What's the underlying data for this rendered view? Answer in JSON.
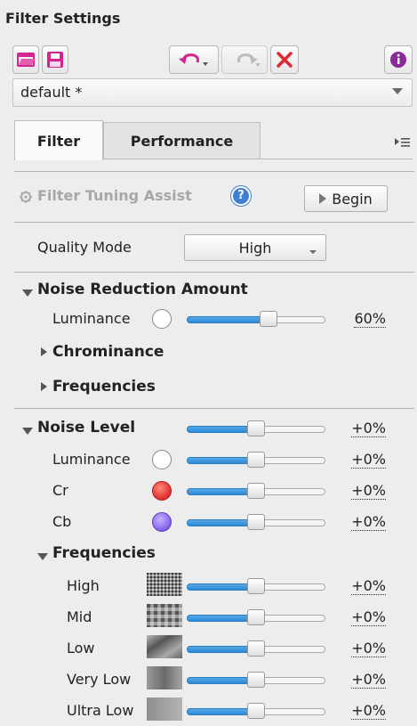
{
  "panel": {
    "title": "Filter Settings"
  },
  "preset": {
    "value": "default *"
  },
  "tabs": [
    {
      "label": "Filter"
    },
    {
      "label": "Performance"
    }
  ],
  "assist": {
    "label": "Filter Tuning Assist",
    "help": "?",
    "begin_label": "Begin"
  },
  "quality": {
    "label": "Quality Mode",
    "value": "High"
  },
  "noise_reduction": {
    "title": "Noise Reduction Amount",
    "luminance": {
      "label": "Luminance",
      "value": "60%",
      "fraction": 0.6
    },
    "chrominance": {
      "label": "Chrominance"
    },
    "frequencies": {
      "label": "Frequencies"
    }
  },
  "noise_level": {
    "title": "Noise Level",
    "main": {
      "value": "+0%",
      "fraction": 0.5
    },
    "luminance": {
      "label": "Luminance",
      "value": "+0%",
      "fraction": 0.5
    },
    "cr": {
      "label": "Cr",
      "value": "+0%",
      "fraction": 0.5
    },
    "cb": {
      "label": "Cb",
      "value": "+0%",
      "fraction": 0.5
    },
    "frequencies_title": "Frequencies",
    "frequencies": [
      {
        "label": "High",
        "value": "+0%",
        "fraction": 0.5
      },
      {
        "label": "Mid",
        "value": "+0%",
        "fraction": 0.5
      },
      {
        "label": "Low",
        "value": "+0%",
        "fraction": 0.5
      },
      {
        "label": "Very Low",
        "value": "+0%",
        "fraction": 0.5
      },
      {
        "label": "Ultra Low",
        "value": "+0%",
        "fraction": 0.5
      }
    ]
  },
  "colors": {
    "accent": "#2d8ad6",
    "cr_color": "#e53935",
    "cb_color": "#8e6cf0"
  },
  "icons": [
    "open-folder-icon",
    "save-icon",
    "undo-icon",
    "redo-icon",
    "reset-icon",
    "info-icon",
    "gear-icon",
    "help-icon",
    "panel-menu-icon"
  ]
}
